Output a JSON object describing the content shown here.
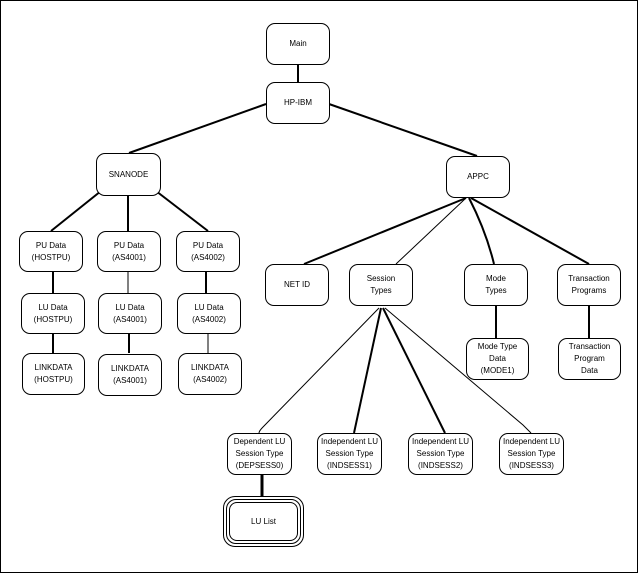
{
  "nodes": {
    "main": "Main",
    "hpibm": "HP-IBM",
    "snanode": "SNANODE",
    "appc": "APPC",
    "pu_hostpu": "PU Data\n(HOSTPU)",
    "pu_as4001": "PU Data\n(AS4001)",
    "pu_as4002": "PU Data\n(AS4002)",
    "lu_hostpu": "LU Data\n(HOSTPU)",
    "lu_as4001": "LU Data\n(AS4001)",
    "lu_as4002": "LU Data\n(AS4002)",
    "link_hostpu": "LINKDATA\n(HOSTPU)",
    "link_as4001": "LINKDATA\n(AS4001)",
    "link_as4002": "LINKDATA\n(AS4002)",
    "netid": "NET ID",
    "session_types": "Session\nTypes",
    "mode_types": "Mode\nTypes",
    "transaction_programs": "Transaction\nPrograms",
    "mode_type_data": "Mode Type\nData\n(MODE1)",
    "transaction_program_data": "Transaction\nProgram\nData",
    "dep_session": "Dependent LU\nSession Type\n(DEPSESS0)",
    "ind_session1": "Independent LU\nSession Type\n(INDSESS1)",
    "ind_session2": "Independent LU\nSession Type\n(INDSESS2)",
    "ind_session3": "Independent LU\nSession Type\n(INDSESS3)",
    "lu_list": "LU List"
  }
}
